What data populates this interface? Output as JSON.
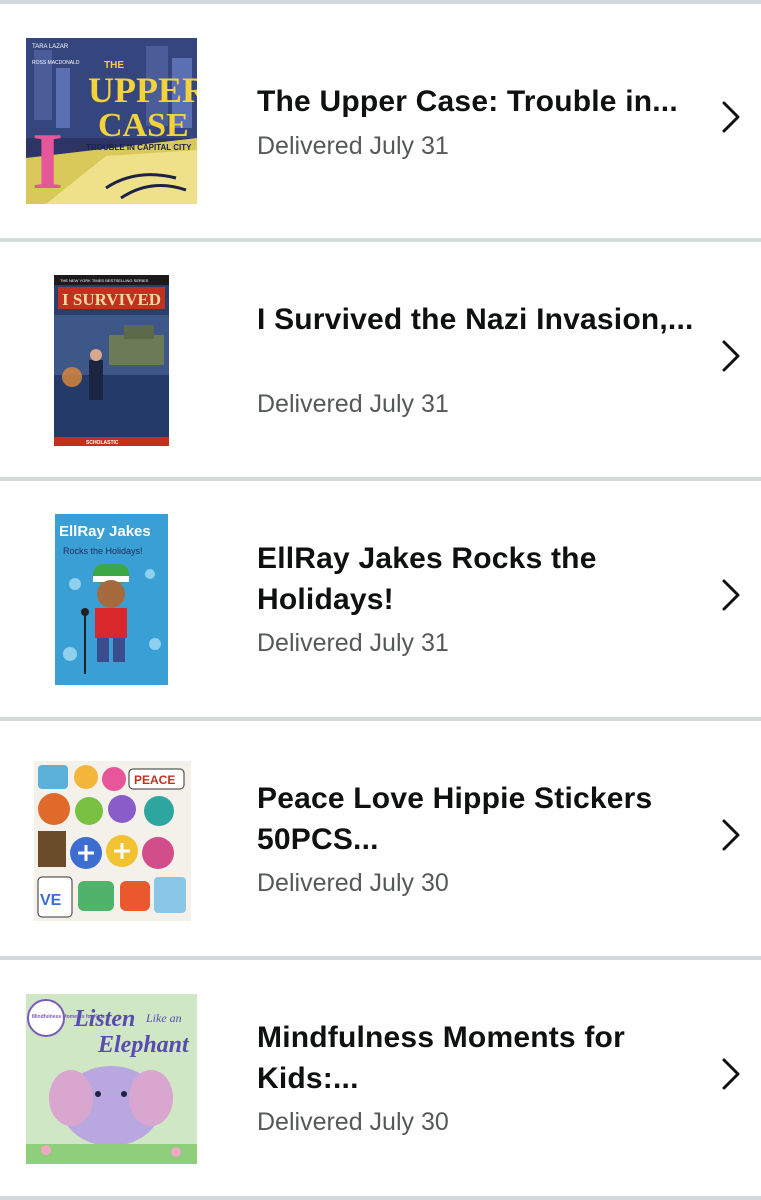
{
  "orders": [
    {
      "title": "The Upper Case: Trouble in...",
      "status": "Delivered July 31",
      "cover": {
        "top_text": "TARA LAZAR",
        "author2": "ROSS MACDONALD",
        "line1": "THE",
        "line2": "UPPER",
        "line3": "CASE",
        "subtitle": "TROUBLE IN CAPITAL CITY",
        "letter": "I"
      }
    },
    {
      "title": "I Survived the Nazi Invasion,...",
      "status": "Delivered July 31",
      "cover": {
        "banner": "THE NEW YORK TIMES BESTSELLING SERIES",
        "series": "I SURVIVED",
        "publisher": "SCHOLASTIC"
      }
    },
    {
      "title": "EllRay Jakes Rocks the Holidays!",
      "status": "Delivered July 31",
      "cover": {
        "line1": "EllRay Jakes",
        "line2": "Rocks the Holidays!"
      }
    },
    {
      "title": "Peace Love Hippie Stickers 50PCS...",
      "status": "Delivered July 30",
      "cover": {
        "sticker1": "PEACE",
        "sticker2": "VE"
      }
    },
    {
      "title": "Mindfulness Moments for Kids:...",
      "status": "Delivered July 30",
      "cover": {
        "series": "Mindfulness Moments for Kids",
        "line1": "Listen",
        "line2": "Like an",
        "line3": "Elephant"
      }
    }
  ],
  "colors": {
    "title": "#0f1111",
    "status": "#565959",
    "divider": "#d5d9d9",
    "chevron": "#0f1111"
  },
  "icons": {
    "chevron": "chevron-right-icon"
  }
}
